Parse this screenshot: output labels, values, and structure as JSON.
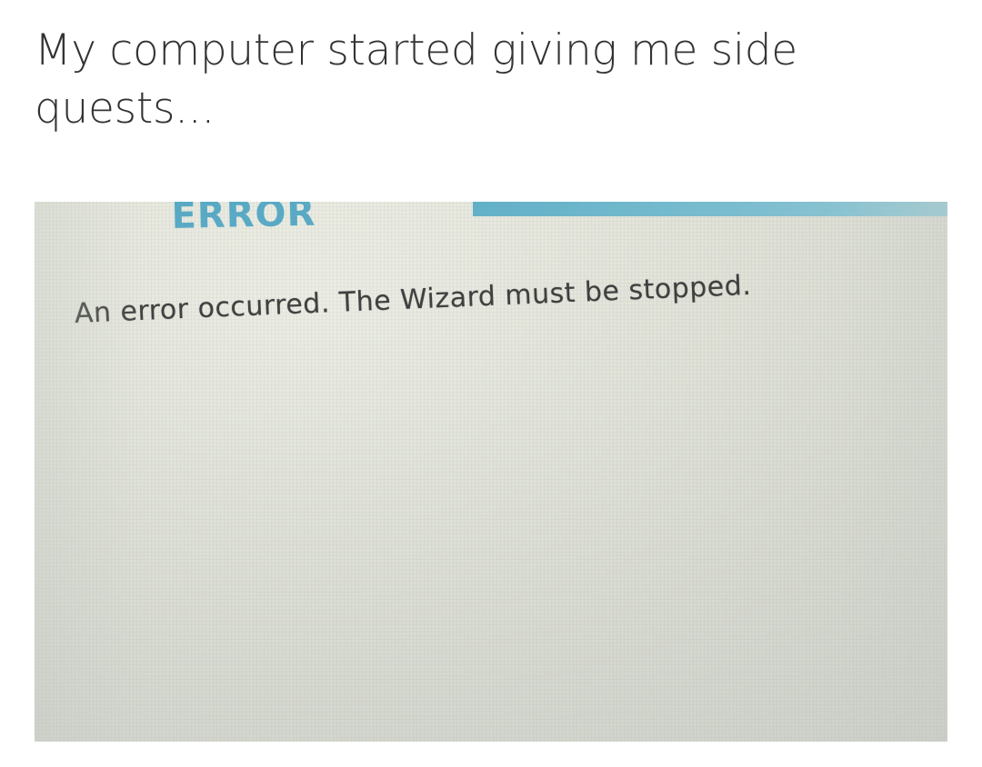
{
  "caption": {
    "text": "My computer started giving me side quests..."
  },
  "dialog": {
    "heading": "ERROR",
    "message": "An error occurred. The Wizard must be stopped.",
    "colors": {
      "heading": "#4aa3c2",
      "accent_bar": "#4ba7c4",
      "message_text": "#3a3a3a",
      "background": "#e2e4da"
    }
  }
}
